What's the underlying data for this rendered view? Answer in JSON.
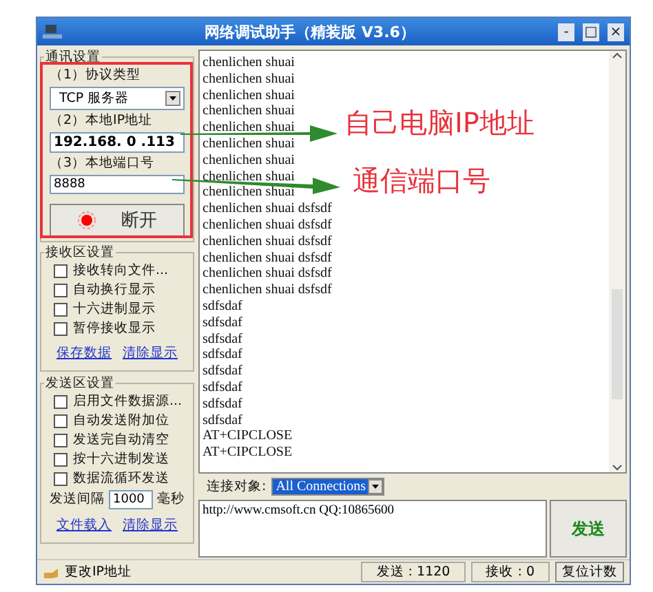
{
  "window": {
    "title": "网络调试助手（精装版 V3.6）",
    "controls": [
      "-",
      "□",
      "×"
    ]
  },
  "net_settings": {
    "legend": "通讯设置",
    "protocol_label": "（1）协议类型",
    "protocol": "TCP 服务器",
    "ip_label": "（2）本地IP地址",
    "ip": "192.168. 0 .113",
    "port_label": "（3）本地端口号",
    "port": "8888",
    "connect_button": "断开",
    "connected": true
  },
  "receive_settings": {
    "legend": "接收区设置",
    "options": [
      {
        "label": "接收转向文件...",
        "checked": false
      },
      {
        "label": "自动换行显示",
        "checked": false
      },
      {
        "label": "十六进制显示",
        "checked": false
      },
      {
        "label": "暂停接收显示",
        "checked": false
      }
    ],
    "links": [
      "保存数据",
      "清除显示"
    ]
  },
  "send_settings": {
    "legend": "发送区设置",
    "options": [
      {
        "label": "启用文件数据源...",
        "checked": false
      },
      {
        "label": "自动发送附加位",
        "checked": false
      },
      {
        "label": "发送完自动清空",
        "checked": false
      },
      {
        "label": "按十六进制发送",
        "checked": false
      },
      {
        "label": "数据流循环发送",
        "checked": false
      }
    ],
    "interval_label": "发送间隔",
    "interval": "1000",
    "interval_unit": "毫秒",
    "links": [
      "文件载入",
      "清除显示"
    ]
  },
  "receive_log": [
    "chenlichen shuai",
    "chenlichen shuai",
    "chenlichen shuai",
    "chenlichen shuai",
    "chenlichen shuai",
    "chenlichen shuai",
    "chenlichen shuai",
    "chenlichen shuai",
    "chenlichen shuai",
    "chenlichen shuai dsfsdf",
    "chenlichen shuai dsfsdf",
    "chenlichen shuai dsfsdf",
    "chenlichen shuai dsfsdf",
    "chenlichen shuai dsfsdf",
    "chenlichen shuai dsfsdf",
    "sdfsdaf",
    "sdfsdaf",
    "sdfsdaf",
    "sdfsdaf",
    "sdfsdaf",
    "sdfsdaf",
    "sdfsdaf",
    "sdfsdaf",
    "AT+CIPCLOSE",
    "AT+CIPCLOSE"
  ],
  "connection": {
    "label": "连接对象:",
    "value": "All Connections"
  },
  "send_text": "http://www.cmsoft.cn QQ:10865600",
  "send_button": "发送",
  "status_bar": {
    "message": "更改IP地址",
    "sent": "发送 : 1120",
    "received": "接收 : 0",
    "reset_button": "复位计数"
  },
  "annotations": [
    {
      "text": "自己电脑IP地址",
      "color": "#e8323c"
    },
    {
      "text": "通信端口号",
      "color": "#e8323c"
    }
  ]
}
